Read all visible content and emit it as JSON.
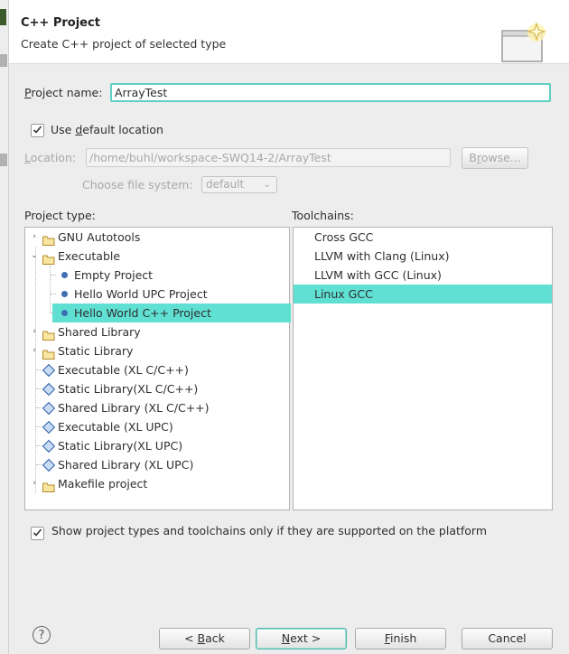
{
  "header": {
    "title": "C++ Project",
    "subtitle": "Create C++ project of selected type"
  },
  "project_name": {
    "label_u": "P",
    "label_rest": "roject name:",
    "value": "ArrayTest"
  },
  "default_location": {
    "label_pre": "Use ",
    "label_u": "d",
    "label_rest": "efault location",
    "checked": true
  },
  "location": {
    "label_u": "L",
    "label_rest": "ocation:",
    "value": "/home/buhl/workspace-SWQ14-2/ArrayTest",
    "browse_pre": "B",
    "browse_u": "r",
    "browse_rest": "owse..."
  },
  "file_system": {
    "label": "Choose file system:",
    "value": "default"
  },
  "project_type": {
    "label": "Project type:",
    "items": [
      {
        "label": "GNU Autotools",
        "icon": "folder",
        "arrow": "›"
      },
      {
        "label": "Executable",
        "icon": "folder",
        "arrow": "⌄"
      },
      {
        "label": "Empty Project",
        "icon": "dot"
      },
      {
        "label": "Hello World UPC Project",
        "icon": "dot"
      },
      {
        "label": "Hello World C++ Project",
        "icon": "dot",
        "selected": true
      },
      {
        "label": "Shared Library",
        "icon": "folder",
        "arrow": "›"
      },
      {
        "label": "Static Library",
        "icon": "folder",
        "arrow": "›"
      },
      {
        "label": "Executable (XL C/C++)",
        "icon": "diamond"
      },
      {
        "label": "Static Library(XL C/C++)",
        "icon": "diamond"
      },
      {
        "label": "Shared Library (XL C/C++)",
        "icon": "diamond"
      },
      {
        "label": "Executable (XL UPC)",
        "icon": "diamond"
      },
      {
        "label": "Static Library(XL UPC)",
        "icon": "diamond"
      },
      {
        "label": "Shared Library (XL UPC)",
        "icon": "diamond"
      },
      {
        "label": "Makefile project",
        "icon": "folder",
        "arrow": "›"
      }
    ]
  },
  "toolchains": {
    "label": "Toolchains:",
    "items": [
      {
        "label": "Cross GCC"
      },
      {
        "label": "LLVM with Clang (Linux)"
      },
      {
        "label": "LLVM with GCC (Linux)"
      },
      {
        "label": "Linux GCC",
        "selected": true
      }
    ]
  },
  "show_supported": {
    "label": "Show project types and toolchains only if they are supported on the platform",
    "checked": true
  },
  "buttons": {
    "help": "?",
    "back_pre": "< ",
    "back_u": "B",
    "back_rest": "ack",
    "next_u": "N",
    "next_rest": "ext >",
    "finish_u": "F",
    "finish_rest": "inish",
    "cancel": "Cancel"
  }
}
